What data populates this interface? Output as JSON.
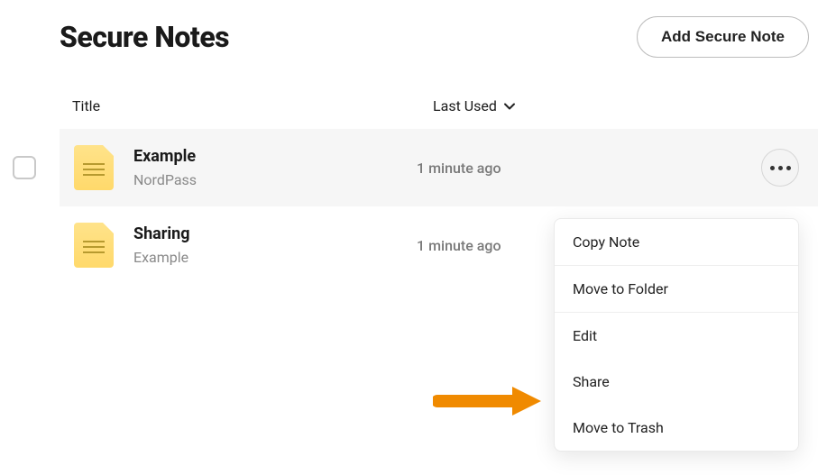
{
  "header": {
    "title": "Secure Notes",
    "add_label": "Add Secure Note"
  },
  "columns": {
    "title": "Title",
    "last_used": "Last Used"
  },
  "rows": [
    {
      "title": "Example",
      "subtitle": "NordPass",
      "last_used": "1 minute ago",
      "selected": true,
      "show_actions": true
    },
    {
      "title": "Sharing",
      "subtitle": "Example",
      "last_used": "1 minute ago",
      "selected": false,
      "show_actions": false
    }
  ],
  "menu": {
    "copy": "Copy Note",
    "move_folder": "Move to Folder",
    "edit": "Edit",
    "share": "Share",
    "trash": "Move to Trash"
  }
}
